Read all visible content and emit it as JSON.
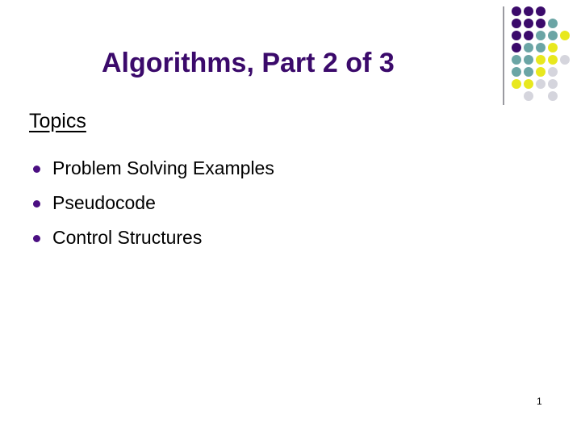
{
  "slide": {
    "title": "Algorithms, Part 2 of 3",
    "page_number": "1",
    "background_color": "#ffffff",
    "title_color": "#3b0a6b"
  },
  "topics": {
    "heading": "Topics",
    "heading_color": "#000000",
    "bullet_color": "#4b0f82",
    "items": [
      {
        "label": "Problem Solving Examples"
      },
      {
        "label": "Pseudocode"
      },
      {
        "label": "Control Structures"
      }
    ]
  },
  "decoration": {
    "rule_color": "#9a9aa0",
    "palette": {
      "purple": "#3b0a6b",
      "teal": "#6ba5a5",
      "yellow": "#e8e81e",
      "gray": "#d5d5dd"
    },
    "dot_diameter": 12,
    "cell_size": 15,
    "dots": [
      {
        "row": 0,
        "col": 0,
        "color": "#3b0a6b"
      },
      {
        "row": 0,
        "col": 1,
        "color": "#3b0a6b"
      },
      {
        "row": 0,
        "col": 2,
        "color": "#3b0a6b"
      },
      {
        "row": 1,
        "col": 0,
        "color": "#3b0a6b"
      },
      {
        "row": 1,
        "col": 1,
        "color": "#3b0a6b"
      },
      {
        "row": 1,
        "col": 2,
        "color": "#3b0a6b"
      },
      {
        "row": 1,
        "col": 3,
        "color": "#6ba5a5"
      },
      {
        "row": 2,
        "col": 0,
        "color": "#3b0a6b"
      },
      {
        "row": 2,
        "col": 1,
        "color": "#3b0a6b"
      },
      {
        "row": 2,
        "col": 2,
        "color": "#6ba5a5"
      },
      {
        "row": 2,
        "col": 3,
        "color": "#6ba5a5"
      },
      {
        "row": 2,
        "col": 4,
        "color": "#e8e81e"
      },
      {
        "row": 3,
        "col": 0,
        "color": "#3b0a6b"
      },
      {
        "row": 3,
        "col": 1,
        "color": "#6ba5a5"
      },
      {
        "row": 3,
        "col": 2,
        "color": "#6ba5a5"
      },
      {
        "row": 3,
        "col": 3,
        "color": "#e8e81e"
      },
      {
        "row": 4,
        "col": 0,
        "color": "#6ba5a5"
      },
      {
        "row": 4,
        "col": 1,
        "color": "#6ba5a5"
      },
      {
        "row": 4,
        "col": 2,
        "color": "#e8e81e"
      },
      {
        "row": 4,
        "col": 3,
        "color": "#e8e81e"
      },
      {
        "row": 4,
        "col": 4,
        "color": "#d5d5dd"
      },
      {
        "row": 5,
        "col": 0,
        "color": "#6ba5a5"
      },
      {
        "row": 5,
        "col": 1,
        "color": "#6ba5a5"
      },
      {
        "row": 5,
        "col": 2,
        "color": "#e8e81e"
      },
      {
        "row": 5,
        "col": 3,
        "color": "#d5d5dd"
      },
      {
        "row": 6,
        "col": 0,
        "color": "#e8e81e"
      },
      {
        "row": 6,
        "col": 1,
        "color": "#e8e81e"
      },
      {
        "row": 6,
        "col": 2,
        "color": "#d5d5dd"
      },
      {
        "row": 6,
        "col": 3,
        "color": "#d5d5dd"
      },
      {
        "row": 7,
        "col": 1,
        "color": "#d5d5dd"
      },
      {
        "row": 7,
        "col": 3,
        "color": "#d5d5dd"
      }
    ]
  }
}
